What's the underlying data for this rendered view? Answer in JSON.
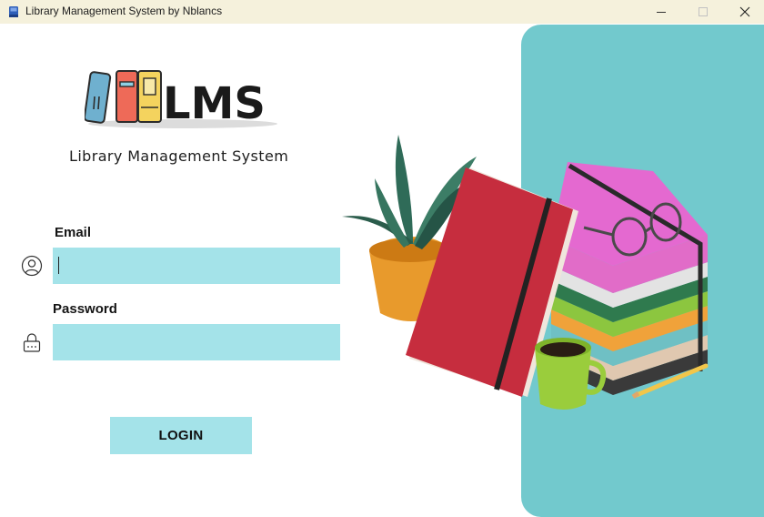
{
  "window": {
    "title": "Library Management System by Nblancs",
    "minimize_glyph": "—",
    "maximize_glyph": "□",
    "close_glyph": "✕"
  },
  "logo": {
    "text": "LMS"
  },
  "subtitle": "Library Management System",
  "form": {
    "email_label": "Email",
    "email_value": "",
    "email_placeholder": "",
    "password_label": "Password",
    "password_value": "",
    "password_placeholder": "",
    "login_label": "LOGIN"
  },
  "icons": {
    "app": "books-app-icon",
    "email": "user-circle-icon",
    "password": "lock-icon",
    "illustration": "book-stack-illustration"
  },
  "colors": {
    "titlebar": "#f5f1dc",
    "input_fill": "#a4e3e9",
    "button_fill": "#a4e3e9",
    "panel_teal": "#72c9cd"
  }
}
